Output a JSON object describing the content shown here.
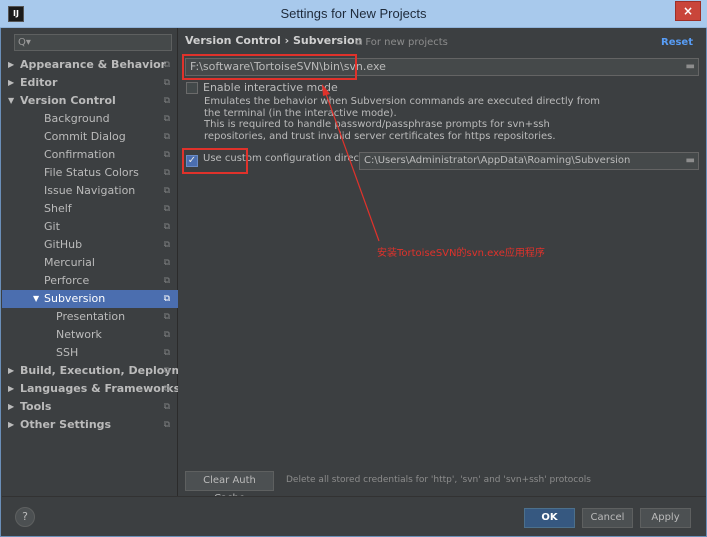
{
  "window": {
    "app_icon": "IJ",
    "title": "Settings for New Projects",
    "close_glyph": "×"
  },
  "sidebar": {
    "search_placeholder": "",
    "search_icon": "Q▾",
    "items": [
      {
        "label": "Appearance & Behavior",
        "level": 0,
        "arrow": "▶",
        "bold": true
      },
      {
        "label": "Editor",
        "level": 0,
        "arrow": "▶",
        "bold": true
      },
      {
        "label": "Version Control",
        "level": 0,
        "arrow": "▼",
        "bold": true
      },
      {
        "label": "Background",
        "level": 1
      },
      {
        "label": "Commit Dialog",
        "level": 1
      },
      {
        "label": "Confirmation",
        "level": 1
      },
      {
        "label": "File Status Colors",
        "level": 1
      },
      {
        "label": "Issue Navigation",
        "level": 1
      },
      {
        "label": "Shelf",
        "level": 1
      },
      {
        "label": "Git",
        "level": 1
      },
      {
        "label": "GitHub",
        "level": 1
      },
      {
        "label": "Mercurial",
        "level": 1
      },
      {
        "label": "Perforce",
        "level": 1
      },
      {
        "label": "Subversion",
        "level": 1,
        "arrow": "▼",
        "selected": true
      },
      {
        "label": "Presentation",
        "level": 2
      },
      {
        "label": "Network",
        "level": 2
      },
      {
        "label": "SSH",
        "level": 2
      },
      {
        "label": "Build, Execution, Deploymen",
        "level": 0,
        "arrow": "▶",
        "bold": true
      },
      {
        "label": "Languages & Frameworks",
        "level": 0,
        "arrow": "▶",
        "bold": true
      },
      {
        "label": "Tools",
        "level": 0,
        "arrow": "▶",
        "bold": true
      },
      {
        "label": "Other Settings",
        "level": 0,
        "arrow": "▶",
        "bold": true
      }
    ]
  },
  "content": {
    "breadcrumb": "Version Control  ›  Subversion",
    "for_new_projects": "⧉ For new projects",
    "reset": "Reset",
    "svn_path": "F:\\software\\TortoiseSVN\\bin\\svn.exe",
    "interactive_mode": {
      "label": "Enable interactive mode",
      "checked": false,
      "description_lines": [
        "Emulates the behavior when Subversion commands are executed directly from",
        "the terminal (in the interactive mode).",
        "This is required to handle password/passphrase prompts for svn+ssh",
        "repositories, and trust invalid server certificates for https repositories."
      ]
    },
    "custom_config": {
      "label": "Use custom configuration directory:",
      "checked": true,
      "path": "C:\\Users\\Administrator\\AppData\\Roaming\\Subversion"
    },
    "annotation": "安装TortoiseSVN的svn.exe应用程序",
    "clear_auth_cache": "Clear Auth Cache",
    "clear_auth_note": "Delete all stored credentials for 'http', 'svn' and 'svn+ssh' protocols"
  },
  "footer": {
    "help": "?",
    "ok": "OK",
    "cancel": "Cancel",
    "apply": "Apply"
  },
  "colors": {
    "selection": "#4b6eaf",
    "annotation_red": "#e0322b",
    "link_blue": "#589df6"
  }
}
